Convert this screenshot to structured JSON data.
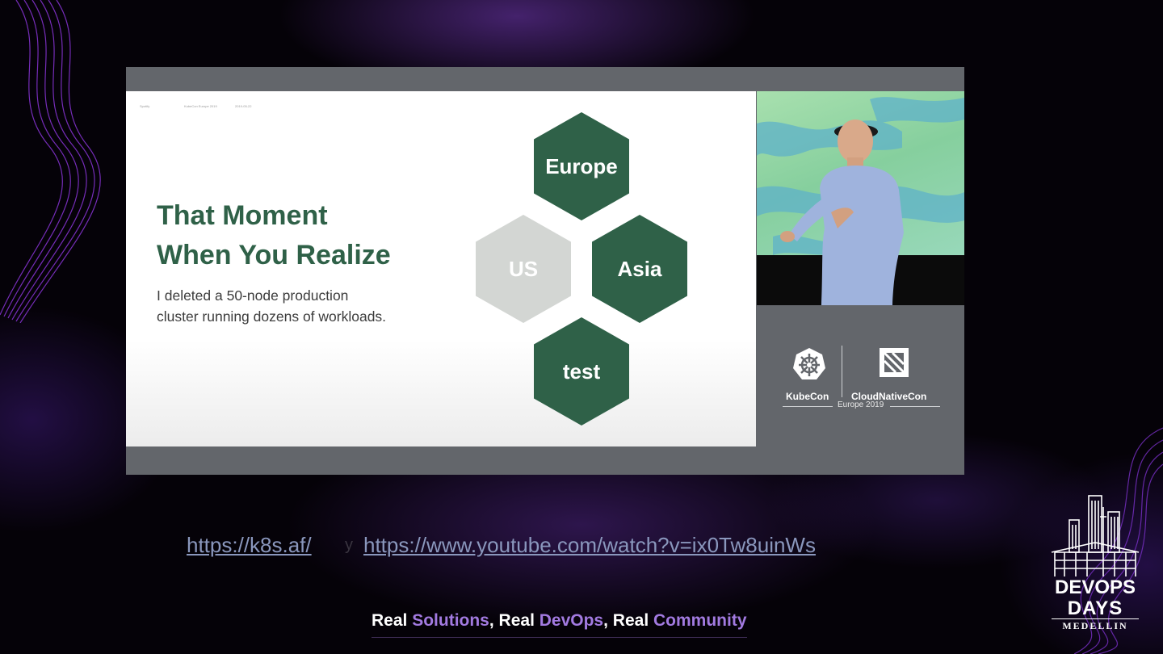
{
  "slide": {
    "meta": {
      "speaker": "Spotify",
      "event": "KubeCon Europe 2019",
      "date": "2019-05-22"
    },
    "title_line1": "That Moment",
    "title_line2": "When You Realize",
    "body_line1": "I deleted a 50-node production",
    "body_line2": "cluster running dozens of workloads.",
    "hexagons": {
      "europe": "Europe",
      "us": "US",
      "asia": "Asia",
      "test": "test"
    }
  },
  "conference": {
    "kubecon": "KubeCon",
    "cloudnativecon": "CloudNativeCon",
    "edition": "Europe 2019"
  },
  "links": {
    "site": "https://k8s.af/",
    "separator": "y",
    "video": "https://www.youtube.com/watch?v=ix0Tw8uinWs"
  },
  "tagline": {
    "p1": "Real ",
    "p2": "Solutions",
    "p3": ", Real ",
    "p4": "DevOps",
    "p5": ", Real ",
    "p6": "Community"
  },
  "devopsdays": {
    "line1": "DEVOPS",
    "line2": "DAYS",
    "city": "MEDELLIN"
  },
  "colors": {
    "slide_green": "#2f6148",
    "hex_grey": "#d3d6d3",
    "video_frame": "#63666b",
    "link": "#8a97bd",
    "accent_purple": "#a27ae0"
  }
}
